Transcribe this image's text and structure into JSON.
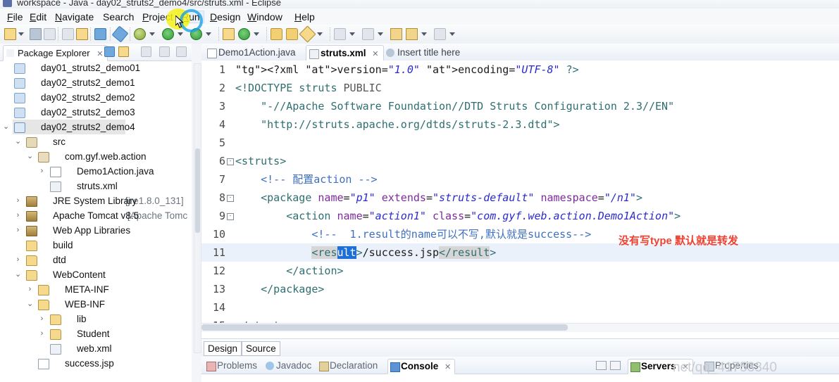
{
  "window": {
    "title": "workspace - Java - day02_struts2_demo4/src/struts.xml - Eclipse"
  },
  "menubar": {
    "items": [
      {
        "label": "File",
        "mnemonic": "F",
        "active": false
      },
      {
        "label": "Edit",
        "mnemonic": "E",
        "active": false
      },
      {
        "label": "Navigate",
        "mnemonic": "N",
        "active": false
      },
      {
        "label": "Search",
        "mnemonic": "",
        "active": false
      },
      {
        "label": "Project",
        "mnemonic": "P",
        "active": false
      },
      {
        "label": "Run",
        "mnemonic": "R",
        "active": true
      },
      {
        "label": "Design",
        "mnemonic": "D",
        "active": false
      },
      {
        "label": "Window",
        "mnemonic": "W",
        "active": false
      },
      {
        "label": "Help",
        "mnemonic": "H",
        "active": false
      }
    ]
  },
  "toolbar": {
    "buttons": [
      {
        "name": "new-wizard",
        "icon": "new-document-icon"
      },
      {
        "name": "save",
        "icon": "save-icon"
      },
      {
        "name": "save-all",
        "icon": "save-all-icon"
      },
      {
        "name": "print",
        "icon": "print-icon"
      },
      {
        "name": "undo-history",
        "icon": "history-icon"
      },
      {
        "name": "open-console",
        "icon": "console-icon"
      },
      {
        "name": "link-editor",
        "icon": "pin-icon"
      },
      {
        "name": "debug",
        "icon": "debug-bug-icon"
      },
      {
        "name": "run",
        "icon": "run-green-play-icon"
      },
      {
        "name": "run-external",
        "icon": "run-external-icon"
      },
      {
        "name": "new-java-package",
        "icon": "package-icon"
      },
      {
        "name": "git",
        "icon": "git-icon"
      },
      {
        "name": "open-type",
        "icon": "open-type-icon"
      },
      {
        "name": "open-task",
        "icon": "open-task-icon"
      },
      {
        "name": "search",
        "icon": "search-pencil-icon"
      },
      {
        "name": "next-annotation",
        "icon": "next-annotation-icon"
      },
      {
        "name": "previous-annotation",
        "icon": "previous-annotation-icon"
      },
      {
        "name": "back",
        "icon": "back-arrow-icon"
      },
      {
        "name": "forward",
        "icon": "forward-arrow-icon"
      },
      {
        "name": "next-edit",
        "icon": "next-edit-icon"
      }
    ]
  },
  "package_explorer": {
    "title": "Package Explorer",
    "close_glyph": "✕",
    "view_tools": [
      {
        "name": "collapse-all-icon"
      },
      {
        "name": "link-with-editor-icon"
      },
      {
        "name": "focus-on-active-task-icon"
      },
      {
        "name": "view-menu-icon"
      },
      {
        "name": "minimize-view-icon"
      },
      {
        "name": "maximize-view-icon"
      }
    ],
    "tree": [
      {
        "label": "day01_struts2_demo01",
        "depth": 0,
        "icon": "project-closed-icon",
        "arrow": "",
        "selected": false,
        "suffix": ""
      },
      {
        "label": "day02_struts2_demo1",
        "depth": 0,
        "icon": "project-closed-icon",
        "arrow": "",
        "selected": false,
        "suffix": ""
      },
      {
        "label": "day02_struts2_demo2",
        "depth": 0,
        "icon": "project-closed-icon",
        "arrow": "",
        "selected": false,
        "suffix": ""
      },
      {
        "label": "day02_struts2_demo3",
        "depth": 0,
        "icon": "project-closed-icon",
        "arrow": "",
        "selected": false,
        "suffix": ""
      },
      {
        "label": "day02_struts2_demo4",
        "depth": 0,
        "icon": "project-open-icon",
        "arrow": "⌄",
        "selected": true,
        "suffix": ""
      },
      {
        "label": "src",
        "depth": 1,
        "icon": "source-folder-icon",
        "arrow": "⌄",
        "selected": false,
        "suffix": ""
      },
      {
        "label": "com.gyf.web.action",
        "depth": 2,
        "icon": "package-icon",
        "arrow": "⌄",
        "selected": false,
        "suffix": ""
      },
      {
        "label": "Demo1Action.java",
        "depth": 3,
        "icon": "java-file-icon",
        "arrow": "›",
        "selected": false,
        "suffix": ""
      },
      {
        "label": "struts.xml",
        "depth": 3,
        "icon": "xml-file-icon",
        "arrow": "",
        "selected": false,
        "suffix": ""
      },
      {
        "label": "JRE System Library",
        "depth": 1,
        "icon": "library-icon",
        "arrow": "›",
        "selected": false,
        "suffix": "[jre1.8.0_131]"
      },
      {
        "label": "Apache Tomcat v8.5",
        "depth": 1,
        "icon": "library-icon",
        "arrow": "›",
        "selected": false,
        "suffix": "[Apache Tomc"
      },
      {
        "label": "Web App Libraries",
        "depth": 1,
        "icon": "library-icon",
        "arrow": "›",
        "selected": false,
        "suffix": ""
      },
      {
        "label": "build",
        "depth": 1,
        "icon": "folder-icon",
        "arrow": "",
        "selected": false,
        "suffix": ""
      },
      {
        "label": "dtd",
        "depth": 1,
        "icon": "folder-icon",
        "arrow": "›",
        "selected": false,
        "suffix": ""
      },
      {
        "label": "WebContent",
        "depth": 1,
        "icon": "folder-icon",
        "arrow": "⌄",
        "selected": false,
        "suffix": ""
      },
      {
        "label": "META-INF",
        "depth": 2,
        "icon": "folder-icon",
        "arrow": "›",
        "selected": false,
        "suffix": ""
      },
      {
        "label": "WEB-INF",
        "depth": 2,
        "icon": "folder-icon",
        "arrow": "⌄",
        "selected": false,
        "suffix": ""
      },
      {
        "label": "lib",
        "depth": 3,
        "icon": "folder-icon",
        "arrow": "›",
        "selected": false,
        "suffix": ""
      },
      {
        "label": "Student",
        "depth": 3,
        "icon": "folder-icon",
        "arrow": "›",
        "selected": false,
        "suffix": ""
      },
      {
        "label": "web.xml",
        "depth": 3,
        "icon": "xml-file-icon",
        "arrow": "",
        "selected": false,
        "suffix": ""
      },
      {
        "label": "success.jsp",
        "depth": 2,
        "icon": "jsp-file-icon",
        "arrow": "",
        "selected": false,
        "suffix": ""
      }
    ]
  },
  "editor": {
    "tabs": [
      {
        "label": "Demo1Action.java",
        "icon": "java-file-icon",
        "active": false,
        "closable": false
      },
      {
        "label": "struts.xml",
        "icon": "xml-file-icon",
        "active": true,
        "closable": true
      },
      {
        "label": "Insert title here",
        "icon": "html-file-icon",
        "active": false,
        "closable": false
      }
    ],
    "close_glyph": "✕",
    "mode_tabs": [
      {
        "label": "Design",
        "active": false
      },
      {
        "label": "Source",
        "active": true
      }
    ],
    "annotation": "没有写type 默认就是转发",
    "lines": [
      {
        "n": "1",
        "fold": "",
        "highlighted": false,
        "text": "<?xml version=\"1.0\" encoding=\"UTF-8\" ?>"
      },
      {
        "n": "2",
        "fold": "",
        "highlighted": false,
        "text": "<!DOCTYPE struts PUBLIC"
      },
      {
        "n": "3",
        "fold": "",
        "highlighted": false,
        "text": "    \"-//Apache Software Foundation//DTD Struts Configuration 2.3//EN\""
      },
      {
        "n": "4",
        "fold": "",
        "highlighted": false,
        "text": "    \"http://struts.apache.org/dtds/struts-2.3.dtd\">"
      },
      {
        "n": "5",
        "fold": "",
        "highlighted": false,
        "text": ""
      },
      {
        "n": "6",
        "fold": "-",
        "highlighted": false,
        "text": "<struts>"
      },
      {
        "n": "7",
        "fold": "",
        "highlighted": false,
        "text": "    <!-- 配置action -->"
      },
      {
        "n": "8",
        "fold": "-",
        "highlighted": false,
        "text": "    <package name=\"p1\" extends=\"struts-default\" namespace=\"/n1\">"
      },
      {
        "n": "9",
        "fold": "-",
        "highlighted": false,
        "text": "        <action name=\"action1\" class=\"com.gyf.web.action.Demo1Action\">"
      },
      {
        "n": "10",
        "fold": "",
        "highlighted": false,
        "text": "            <!--  1.result的name可以不写,默认就是success-->"
      },
      {
        "n": "11",
        "fold": "",
        "highlighted": true,
        "text": "            <result>/success.jsp</result>"
      },
      {
        "n": "12",
        "fold": "",
        "highlighted": false,
        "text": "        </action>"
      },
      {
        "n": "13",
        "fold": "",
        "highlighted": false,
        "text": "    </package>"
      },
      {
        "n": "14",
        "fold": "",
        "highlighted": false,
        "text": ""
      },
      {
        "n": "15",
        "fold": "",
        "highlighted": false,
        "text": "</struts>"
      }
    ],
    "selection": {
      "text": "ult",
      "line": "11"
    }
  },
  "bottom_views": {
    "left_tabs": [
      {
        "label": "Problems",
        "icon": "problems-icon",
        "active": false,
        "closable": false
      },
      {
        "label": "Javadoc",
        "icon": "javadoc-icon",
        "active": false,
        "closable": false
      },
      {
        "label": "Declaration",
        "icon": "declaration-icon",
        "active": false,
        "closable": false
      },
      {
        "label": "Console",
        "icon": "console-icon",
        "active": true,
        "closable": true
      }
    ],
    "right_tabs": [
      {
        "label": "Servers",
        "icon": "servers-icon",
        "active": true,
        "closable": true
      },
      {
        "label": "Properties",
        "icon": "properties-icon",
        "active": false,
        "closable": false
      }
    ],
    "close_glyph": "✕"
  },
  "watermark": {
    "text": "net/qq_41753340"
  },
  "colors": {
    "tag": "#2f6f71",
    "attribute": "#7e2a9e",
    "string": "#2a2ad0",
    "comment": "#3f6fbf",
    "selection": "#1c6ed9",
    "annotation": "#f04030",
    "line_highlight": "#eaf1fb",
    "highlight_circle_yellow": "#f5f11a",
    "highlight_circle_blue": "#1aa0e8"
  }
}
